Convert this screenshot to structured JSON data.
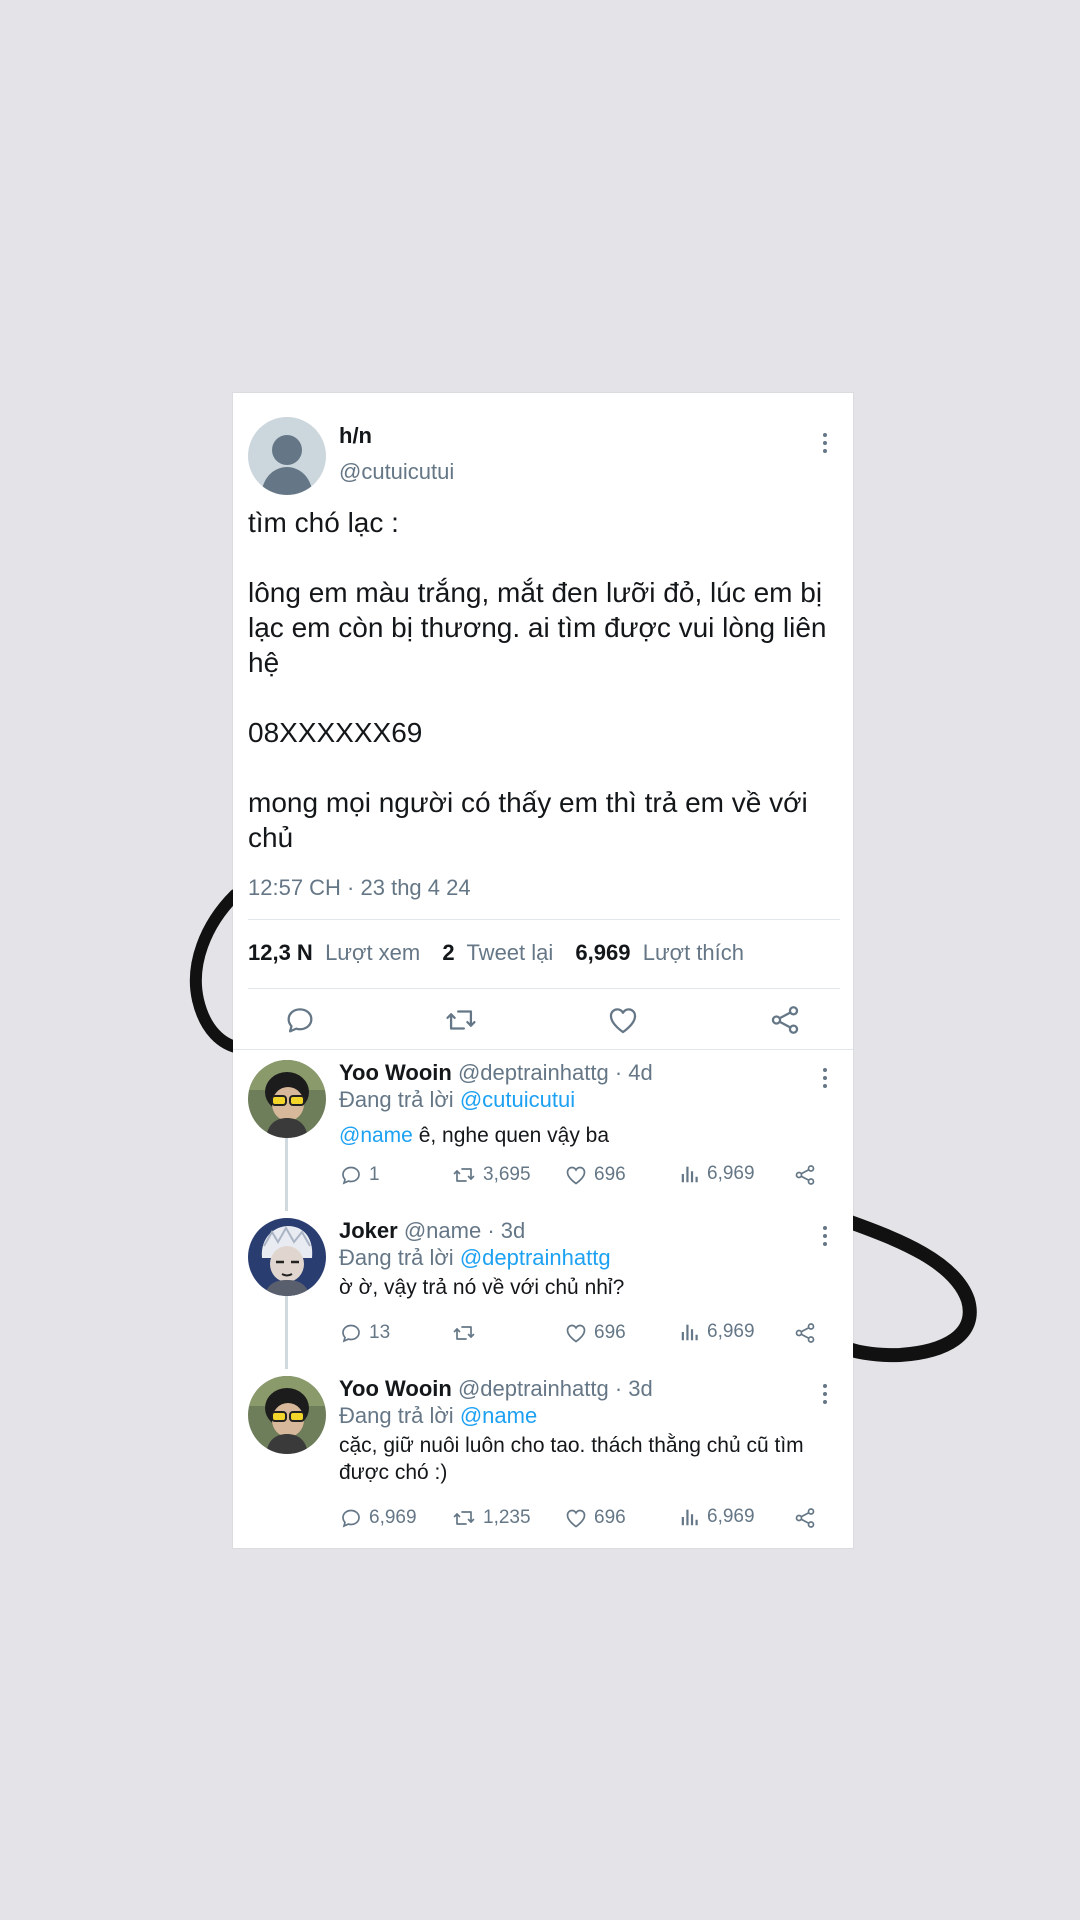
{
  "tweet": {
    "display_name": "h/n",
    "handle": "@cutuicutui",
    "text_lines": [
      "tìm chó lạc :",
      "lông em màu trắng, mắt đen lưỡi đỏ, lúc em bị lạc em còn bị thương. ai tìm được vui lòng liên hệ",
      "08XXXXXX69",
      "mong mọi người có thấy em thì trả em về với chủ"
    ],
    "timestamp": "12:57 CH · 23 thg 4 24",
    "stats": {
      "views_value": "12,3 N",
      "views_label": "Lượt xem",
      "retweets_value": "2",
      "retweets_label": "Tweet lại",
      "likes_value": "6,969",
      "likes_label": "Lượt thích"
    },
    "action_icons": [
      "reply-icon",
      "retweet-icon",
      "like-icon",
      "share-icon"
    ]
  },
  "replies": [
    {
      "name": "Yoo Wooin",
      "handle_time": "@deptrainhattg · 4d",
      "replying_prefix": "Đang trả lời",
      "replying_to": "@cutuicutui",
      "mention": "@name",
      "text": " ê, nghe quen vậy ba",
      "reply_count": "1",
      "retweet_count": "3,695",
      "like_count": "696",
      "view_count": "6,969"
    },
    {
      "name": "Joker",
      "handle_time": "@name · 3d",
      "replying_prefix": "Đang trả lời",
      "replying_to": "@deptrainhattg",
      "mention": "",
      "text": "ờ ờ, vậy trả nó về với chủ nhỉ?",
      "reply_count": "13",
      "retweet_count": "",
      "like_count": "696",
      "view_count": "6,969"
    },
    {
      "name": "Yoo Wooin",
      "handle_time": "@deptrainhattg · 3d",
      "replying_prefix": "Đang trả lời",
      "replying_to": "@name",
      "mention": "",
      "text": "cặc, giữ nuôi luôn cho tao. thách thằng chủ cũ tìm được chó :)",
      "reply_count": "6,969",
      "retweet_count": "1,235",
      "like_count": "696",
      "view_count": "6,969"
    }
  ],
  "colors": {
    "background": "#e4e4e8",
    "card": "#ffffff",
    "text": "#14171a",
    "secondary": "#657786",
    "link": "#1da1f2",
    "divider": "#e1e8ed"
  }
}
